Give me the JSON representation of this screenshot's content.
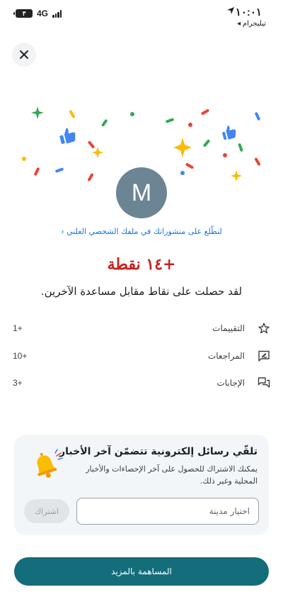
{
  "status_bar": {
    "time": "١٠:٠١",
    "back_app": "◂ تيليجرام",
    "battery": "٣",
    "network": "4G"
  },
  "header": {
    "close_icon": "close-icon"
  },
  "profile": {
    "avatar_initial": "M",
    "link_text": "لنطّلع على منشوراتك في ملفك الشخصي العلني ‹"
  },
  "points": {
    "headline": "+١٤ نقطة",
    "subtitle": "لقد حصلت على نقاط مقابل مساعدة الآخرين."
  },
  "stats": [
    {
      "label": "التقييمات",
      "value": "1+",
      "icon": "star-icon"
    },
    {
      "label": "المراجعات",
      "value": "10+",
      "icon": "review-icon"
    },
    {
      "label": "الإجابات",
      "value": "3+",
      "icon": "answers-icon"
    }
  ],
  "newsletter": {
    "title": "تلقّي رسائل إلكترونية تتضمّن آخر الأخبار",
    "body": "يمكنك الاشتراك للحصول على آخر الإحصاءات والأخبار المحلية وغير ذلك.",
    "input_placeholder": "اختيار مدينة",
    "subscribe_label": "اشتراك",
    "icon": "bell-icon"
  },
  "footer": {
    "contribute_label": "المساهمة بالمزيد"
  },
  "colors": {
    "accent": "#136d7a",
    "points": "#c5221f",
    "link": "#1a73e8",
    "avatar": "#6b8594"
  }
}
